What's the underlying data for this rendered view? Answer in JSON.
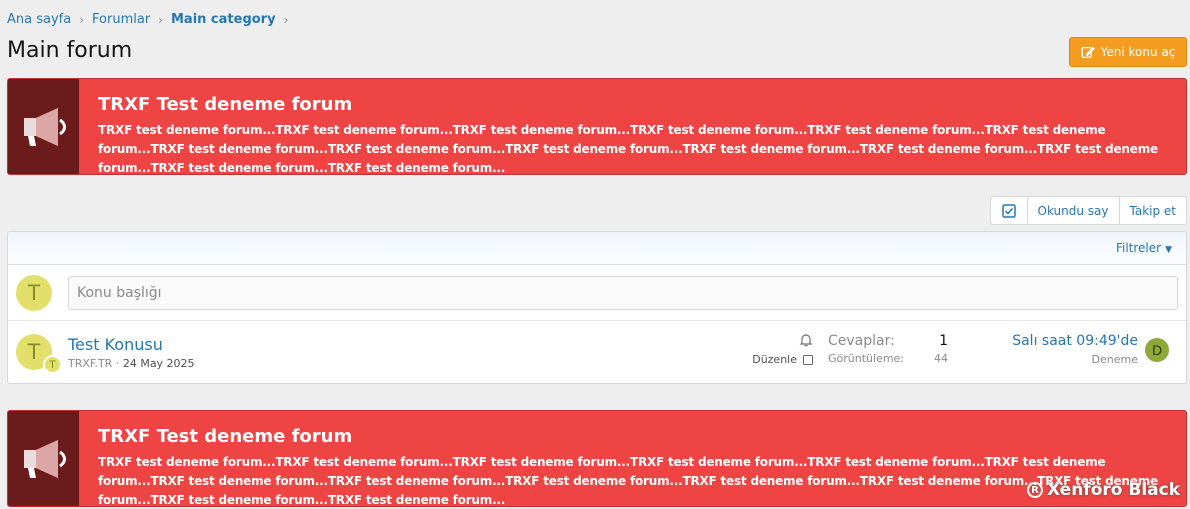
{
  "breadcrumb": {
    "items": [
      "Ana sayfa",
      "Forumlar",
      "Main category"
    ]
  },
  "page": {
    "title": "Main forum",
    "new_thread_label": "Yeni konu aç"
  },
  "notice": {
    "title": "TRXF Test deneme forum",
    "text": "TRXF test deneme forum...TRXF test deneme forum...TRXF test deneme forum...TRXF test deneme forum...TRXF test deneme forum...TRXF test deneme forum...TRXF test deneme forum...TRXF test deneme forum...TRXF test deneme forum...TRXF test deneme forum...TRXF test deneme forum...TRXF test deneme forum...TRXF test deneme forum...TRXF test deneme forum..."
  },
  "actions": {
    "mark_read": "Okundu say",
    "watch": "Takip et"
  },
  "filter": {
    "label": "Filtreler"
  },
  "quick_thread": {
    "avatar_letter": "T",
    "placeholder": "Konu başlığı"
  },
  "thread": {
    "avatar_letter": "T",
    "small_avatar_letter": "T",
    "title": "Test Konusu",
    "author": "TRXF.TR",
    "date": "24 May 2025",
    "edit_label": "Düzenle",
    "replies_label": "Cevaplar:",
    "replies_value": "1",
    "views_label": "Görüntüleme:",
    "views_value": "44",
    "latest_time": "Salı saat 09:49'de",
    "latest_user": "Deneme",
    "latest_avatar_letter": "D"
  },
  "watermark": {
    "text": "Xenforo Black",
    "symbol": "R"
  },
  "colors": {
    "notice_bg": "#ef4444",
    "notice_icon_bg": "#6b1b1b",
    "accent_button": "#f39c1f",
    "link": "#2577b1"
  },
  "icons": {
    "notice_icon": "megaphone-icon",
    "new_thread_icon": "edit-icon",
    "select_icon": "check-square-icon",
    "status_icon": "bell-icon",
    "filter_caret": "caret-down-icon"
  }
}
